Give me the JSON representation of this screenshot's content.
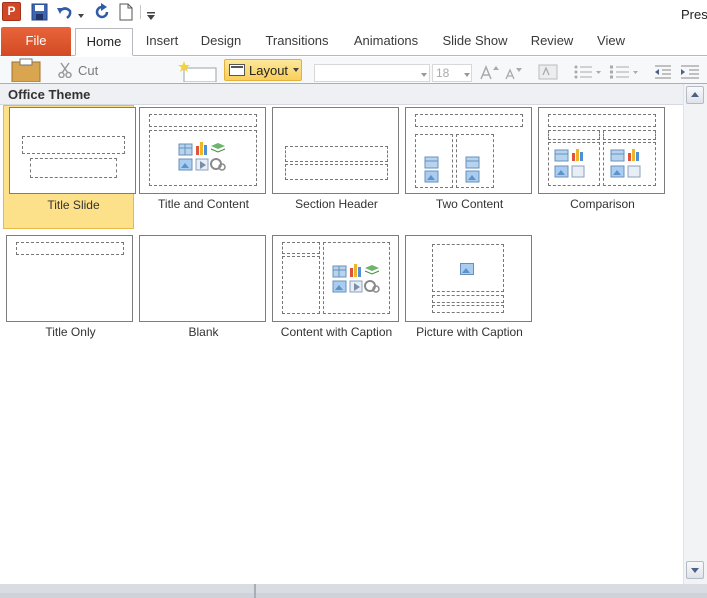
{
  "app": {
    "logo": "P",
    "title": "Pres"
  },
  "quick_access": {
    "icons": [
      "powerpoint-logo-icon",
      "save-icon",
      "undo-icon",
      "redo-icon",
      "new-document-icon",
      "customize-toolbar-icon"
    ]
  },
  "ribbon_tabs": [
    "File",
    "Home",
    "Insert",
    "Design",
    "Transitions",
    "Animations",
    "Slide Show",
    "Review",
    "View"
  ],
  "active_tab": "Home",
  "ribbon": {
    "cut_label": "Cut",
    "layout_label": "Layout",
    "font_size": "18"
  },
  "gallery": {
    "header": "Office Theme",
    "selected": "Title Slide",
    "layouts": [
      {
        "label": "Title Slide"
      },
      {
        "label": "Title and Content"
      },
      {
        "label": "Section Header"
      },
      {
        "label": "Two Content"
      },
      {
        "label": "Comparison"
      },
      {
        "label": "Title Only"
      },
      {
        "label": "Blank"
      },
      {
        "label": "Content with Caption"
      },
      {
        "label": "Picture with Caption"
      }
    ]
  },
  "colors": {
    "file_tab": "#d24a24",
    "selected_highlight": "#fde18a",
    "layout_button": "#f8cf5b"
  }
}
